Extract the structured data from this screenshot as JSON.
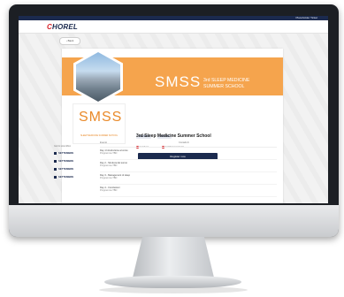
{
  "topbar": {
    "right_text": "Placeholder Ticket"
  },
  "header": {
    "logo_prefix": "C",
    "logo_rest": "HOREL"
  },
  "back_button": {
    "label": "Back"
  },
  "banner": {
    "logo": "SMSS",
    "title_line1": "3rd SLEEP MEDICINE",
    "title_line2": "SUMMER SCHOOL"
  },
  "side_logo": {
    "text": "SMSS",
    "subtitle": "SLEEP MEDICINE SUMMER SCHOOL"
  },
  "badges": [
    "MEETING",
    "CATANIA"
  ],
  "event": {
    "title": "3rd Sleep Medicine Summer School",
    "status": [
      "Concluso",
      "Iscrizioni terminate"
    ],
    "register_label": "Register now"
  },
  "programme": {
    "left_header": "Giorni scientifico",
    "days": [
      "SETTEMBRE",
      "SETTEMBRE",
      "SETTEMBRE",
      "SETTEMBRE"
    ],
    "header_1": "Evento",
    "header_2": "Contatti di",
    "rows": [
      {
        "title": "Day 1 Introduzione al corso",
        "sub": "Programma TBD"
      },
      {
        "title": "Day 2 - Struttura del sonno",
        "sub": "Programma TBD"
      },
      {
        "title": "Day 3 - Management of sleep",
        "sub": "Programma TBD"
      },
      {
        "title": "Day 4 - Conclusioni",
        "sub": "Programma TBD"
      }
    ]
  },
  "colors": {
    "brand_navy": "#1b2a4e",
    "accent_orange": "#f5a44d",
    "logo_red": "#d8232a"
  }
}
